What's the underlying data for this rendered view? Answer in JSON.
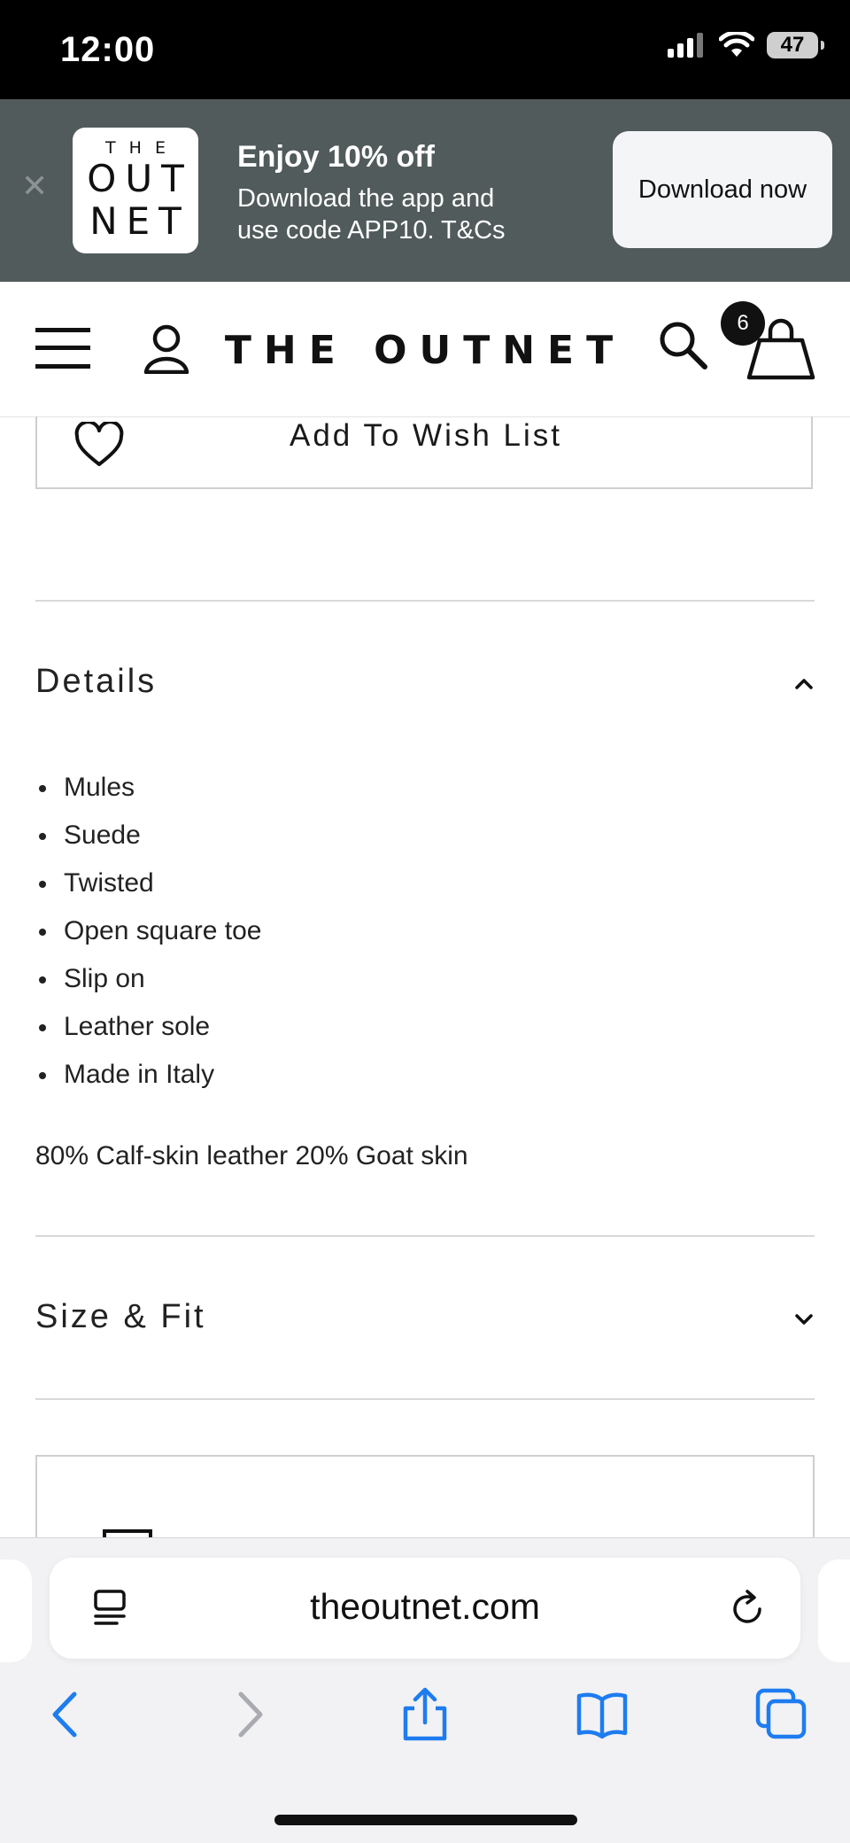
{
  "status_bar": {
    "time": "12:00",
    "battery": "47"
  },
  "app_banner": {
    "logo_line1": "THE",
    "logo_line2": "OUT",
    "logo_line3": "NET",
    "title": "Enjoy 10% off",
    "subtitle": "Download the app and use code APP10. T&Cs",
    "button_label": "Download now"
  },
  "header": {
    "brand": "THE OUTNET",
    "bag_count": "6"
  },
  "wishlist": {
    "label": "Add To Wish List"
  },
  "details": {
    "title": "Details",
    "expanded": true,
    "items": [
      "Mules",
      "Suede",
      "Twisted",
      "Open square toe",
      "Slip on",
      "Leather sole",
      "Made in Italy"
    ],
    "composition": "80% Calf-skin leather 20% Goat skin"
  },
  "size_fit": {
    "title": "Size & Fit",
    "expanded": false
  },
  "browser": {
    "url": "theoutnet.com"
  },
  "colors": {
    "banner_bg": "#525b5b",
    "accent_blue": "#1e7cf0",
    "status_bar_bg": "#000000"
  },
  "icons": [
    "menu-icon",
    "account-icon",
    "search-icon",
    "bag-icon",
    "heart-icon",
    "chevron-up-icon",
    "chevron-down-icon",
    "reader-icon",
    "reload-icon",
    "back-icon",
    "forward-icon",
    "share-icon",
    "bookmarks-icon",
    "tabs-icon"
  ]
}
